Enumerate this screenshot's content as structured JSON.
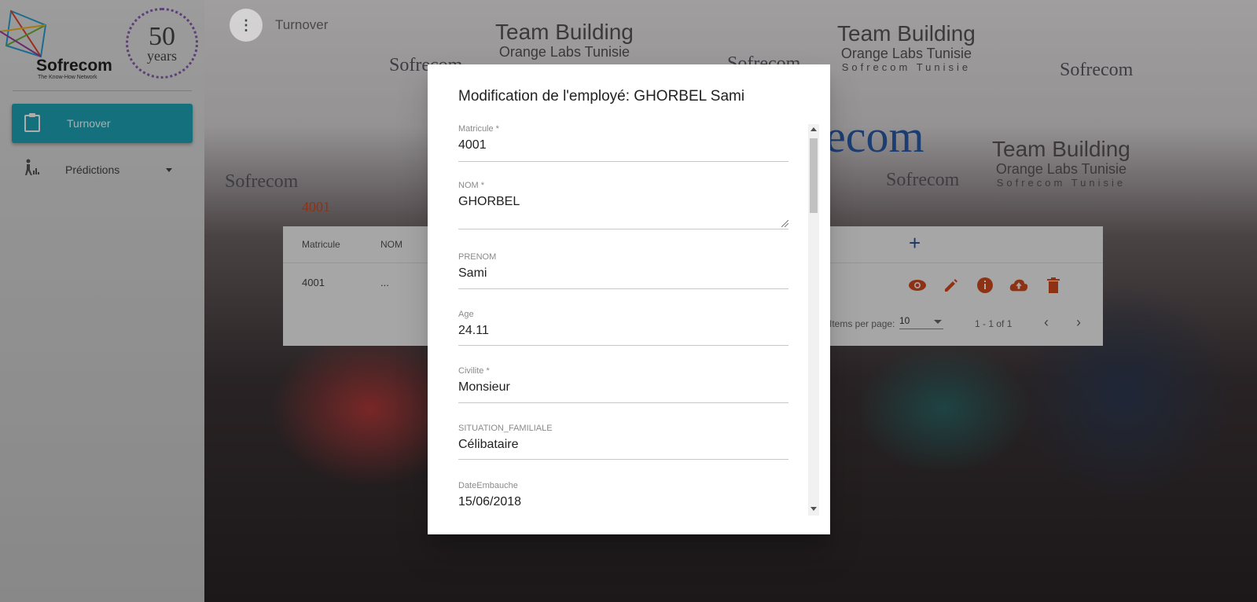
{
  "app": {
    "title": "Turnover",
    "menu_icon": "more-vert-icon"
  },
  "background": {
    "banner_title": "Team Building",
    "banner_sub": "Orange Labs Tunisie",
    "banner_loc": "Sofrecom Tunisie",
    "brand": "Sofrecom"
  },
  "sidebar": {
    "logo_brand": "Sofrecom",
    "logo_tagline": "The Know-How Network",
    "anniversary_number": "50",
    "anniversary_word": "years",
    "items": [
      {
        "label": "Turnover",
        "icon": "clipboard-icon",
        "active": true
      },
      {
        "label": "Prédictions",
        "icon": "person-chart-icon",
        "active": false
      }
    ]
  },
  "table": {
    "section_label": "4001",
    "columns": [
      "Matricule",
      "NOM"
    ],
    "rows": [
      {
        "matricule": "4001",
        "nom": "..."
      }
    ],
    "actions": [
      "view-icon",
      "edit-icon",
      "info-icon",
      "upload-icon",
      "delete-icon"
    ],
    "paginator": {
      "items_per_page_label": "Items per page:",
      "page_size": "10",
      "range": "1 - 1 of 1"
    },
    "colors": {
      "action": "#d24a1e",
      "add": "#2a4fa0"
    }
  },
  "dialog": {
    "title": "Modification de l'employé: GHORBEL Sami",
    "fields": [
      {
        "label": "Matricule *",
        "value": "4001"
      },
      {
        "label": "NOM *",
        "value": "GHORBEL"
      },
      {
        "label": "PRENOM",
        "value": "Sami"
      },
      {
        "label": "Age",
        "value": "24.11"
      },
      {
        "label": "Civilite *",
        "value": "Monsieur"
      },
      {
        "label": "SITUATION_FAMILIALE",
        "value": "Célibataire"
      },
      {
        "label": "DateEmbauche",
        "value": "15/06/2018"
      }
    ]
  }
}
